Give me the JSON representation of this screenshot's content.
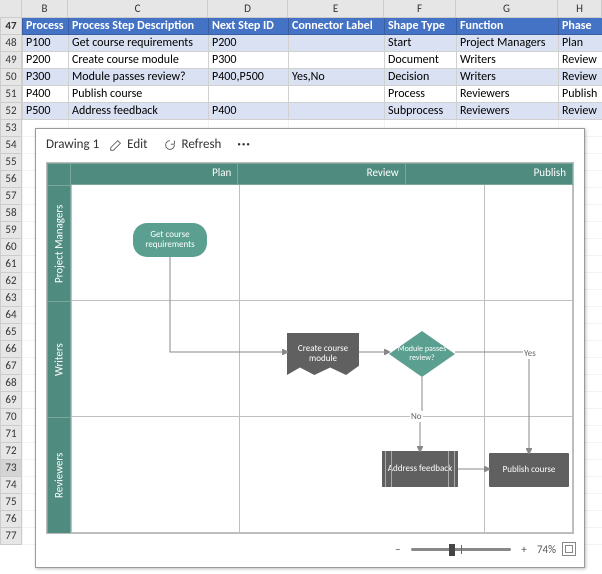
{
  "columns": [
    "B",
    "C",
    "D",
    "E",
    "F",
    "G",
    "H"
  ],
  "row_numbers": [
    47,
    48,
    49,
    50,
    51,
    52,
    53,
    54,
    55,
    56,
    57,
    58,
    59,
    60,
    61,
    62,
    63,
    64,
    65,
    66,
    67,
    68,
    69,
    70,
    71,
    72,
    73,
    74,
    75,
    76,
    77
  ],
  "selected_row": 73,
  "headers": {
    "B": "Process",
    "C": "Process Step Description",
    "D": "Next Step ID",
    "E": "Connector Label",
    "F": "Shape Type",
    "G": "Function",
    "H": "Phase"
  },
  "rows": [
    {
      "cells": {
        "B": "P100",
        "C": "Get course requirements",
        "D": "P200",
        "E": "",
        "F": "Start",
        "G": "Project Managers",
        "H": "Plan"
      }
    },
    {
      "cells": {
        "B": "P200",
        "C": "Create course module",
        "D": "P300",
        "E": "",
        "F": "Document",
        "G": "Writers",
        "H": "Review"
      }
    },
    {
      "cells": {
        "B": "P300",
        "C": "Module passes review?",
        "D": "P400,P500",
        "E": "Yes,No",
        "F": "Decision",
        "G": "Writers",
        "H": "Review"
      }
    },
    {
      "cells": {
        "B": "P400",
        "C": "Publish course",
        "D": "",
        "E": "",
        "F": "Process",
        "G": "Reviewers",
        "H": "Publish"
      }
    },
    {
      "cells": {
        "B": "P500",
        "C": "Address feedback",
        "D": "P400",
        "E": "",
        "F": "Subprocess",
        "G": "Reviewers",
        "H": "Review"
      }
    }
  ],
  "drawing": {
    "title": "Drawing 1",
    "toolbar": {
      "edit": "Edit",
      "refresh": "Refresh",
      "more": "···"
    },
    "phases": [
      "Plan",
      "Review",
      "Publish"
    ],
    "lanes": [
      "Project Managers",
      "Writers",
      "Reviewers"
    ],
    "shapes": {
      "start": "Get course requirements",
      "doc": "Create course module",
      "diamond": "Module passes review?",
      "proc": "Publish course",
      "sub": "Address feedback"
    },
    "labels": {
      "yes": "Yes",
      "no": "No"
    },
    "status": {
      "zoom": "74%"
    }
  },
  "chart_data": {
    "type": "table",
    "headers": [
      "Process",
      "Process Step Description",
      "Next Step ID",
      "Connector Label",
      "Shape Type",
      "Function",
      "Phase"
    ],
    "rows": [
      [
        "P100",
        "Get course requirements",
        "P200",
        "",
        "Start",
        "Project Managers",
        "Plan"
      ],
      [
        "P200",
        "Create course module",
        "P300",
        "",
        "Document",
        "Writers",
        "Review"
      ],
      [
        "P300",
        "Module passes review?",
        "P400,P500",
        "Yes,No",
        "Decision",
        "Writers",
        "Review"
      ],
      [
        "P400",
        "Publish course",
        "",
        "",
        "Process",
        "Reviewers",
        "Publish"
      ],
      [
        "P500",
        "Address feedback",
        "P400",
        "",
        "Subprocess",
        "Reviewers",
        "Review"
      ]
    ],
    "swimlane": {
      "phases": [
        "Plan",
        "Review",
        "Publish"
      ],
      "lanes": [
        "Project Managers",
        "Writers",
        "Reviewers"
      ],
      "flow": [
        {
          "id": "P100",
          "lane": "Project Managers",
          "phase": "Plan",
          "shape": "Start",
          "label": "Get course requirements",
          "next": [
            "P200"
          ]
        },
        {
          "id": "P200",
          "lane": "Writers",
          "phase": "Review",
          "shape": "Document",
          "label": "Create course module",
          "next": [
            "P300"
          ]
        },
        {
          "id": "P300",
          "lane": "Writers",
          "phase": "Review",
          "shape": "Decision",
          "label": "Module passes review?",
          "next": [
            {
              "to": "P400",
              "label": "Yes"
            },
            {
              "to": "P500",
              "label": "No"
            }
          ]
        },
        {
          "id": "P400",
          "lane": "Reviewers",
          "phase": "Publish",
          "shape": "Process",
          "label": "Publish course",
          "next": []
        },
        {
          "id": "P500",
          "lane": "Reviewers",
          "phase": "Review",
          "shape": "Subprocess",
          "label": "Address feedback",
          "next": [
            "P400"
          ]
        }
      ]
    }
  }
}
